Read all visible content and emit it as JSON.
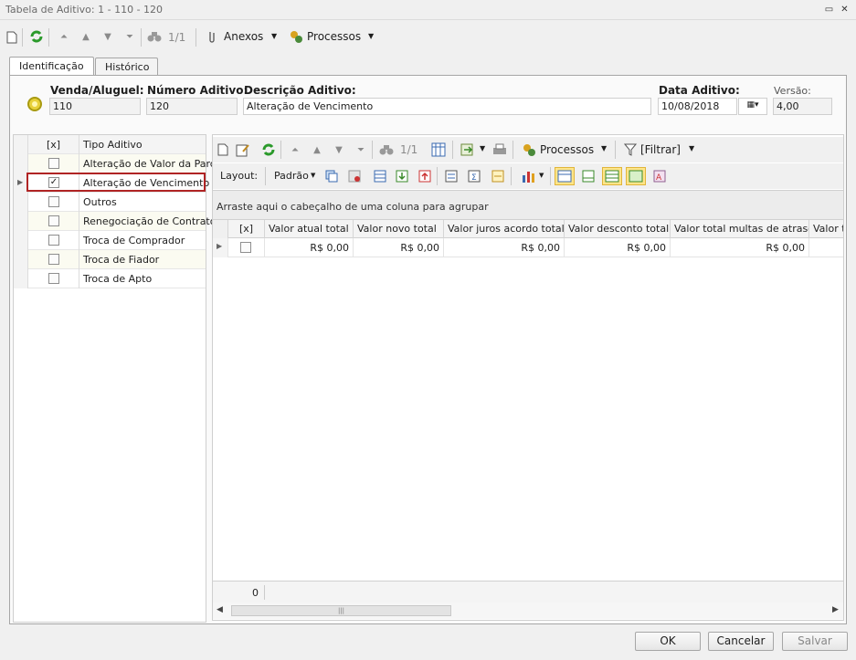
{
  "window": {
    "title": "Tabela de Aditivo: 1 - 110 - 120"
  },
  "toolbar": {
    "page": "1/1",
    "anexos": "Anexos",
    "processos": "Processos"
  },
  "tabs": [
    {
      "label": "Identificação"
    },
    {
      "label": "Histórico"
    }
  ],
  "form": {
    "venda_label": "Venda/Aluguel:",
    "venda_value": "110",
    "numero_label": "Número Aditivo:",
    "numero_value": "120",
    "descricao_label": "Descrição Aditivo:",
    "descricao_value": "Alteração de Vencimento",
    "data_label": "Data Aditivo:",
    "data_value": "10/08/2018",
    "versao_label": "Versão:",
    "versao_value": "4,00"
  },
  "left_grid": {
    "col_check": "[x]",
    "col_tipo": "Tipo Aditivo",
    "rows": [
      {
        "label": "Alteração de Valor da Parcela",
        "checked": false
      },
      {
        "label": "Alteração de Vencimento",
        "checked": true
      },
      {
        "label": "Outros",
        "checked": false
      },
      {
        "label": "Renegociação de Contrato",
        "checked": false
      },
      {
        "label": "Troca de Comprador",
        "checked": false
      },
      {
        "label": "Troca de Fiador",
        "checked": false
      },
      {
        "label": "Troca de Apto",
        "checked": false
      }
    ]
  },
  "right_toolbar": {
    "page": "1/1",
    "processos": "Processos",
    "filtrar": "[Filtrar]",
    "layout_label": "Layout:",
    "padrao": "Padrão"
  },
  "grid": {
    "group_hint": "Arraste aqui o cabeçalho de uma coluna para agrupar",
    "columns": [
      "[x]",
      "Valor atual total",
      "Valor novo total",
      "Valor juros acordo total",
      "Valor desconto total",
      "Valor total multas de atraso",
      "Valor to"
    ],
    "row": [
      "R$ 0,00",
      "R$ 0,00",
      "R$ 0,00",
      "R$ 0,00",
      "R$ 0,00"
    ],
    "footer_count": "0"
  },
  "buttons": {
    "ok": "OK",
    "cancelar": "Cancelar",
    "salvar": "Salvar"
  }
}
